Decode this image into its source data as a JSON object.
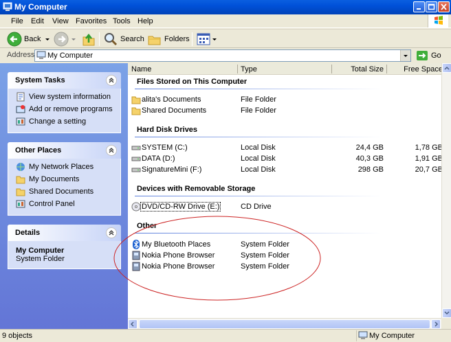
{
  "window": {
    "title": "My Computer"
  },
  "menu": [
    "File",
    "Edit",
    "View",
    "Favorites",
    "Tools",
    "Help"
  ],
  "toolbar": {
    "back": "Back",
    "search": "Search",
    "folders": "Folders"
  },
  "address": {
    "label": "Address",
    "value": "My Computer",
    "go": "Go"
  },
  "left_pane": {
    "system_tasks": {
      "title": "System Tasks",
      "items": [
        "View system information",
        "Add or remove programs",
        "Change a setting"
      ]
    },
    "other_places": {
      "title": "Other Places",
      "items": [
        "My Network Places",
        "My Documents",
        "Shared Documents",
        "Control Panel"
      ]
    },
    "details": {
      "title": "Details",
      "name": "My Computer",
      "desc": "System Folder"
    }
  },
  "columns": {
    "name": "Name",
    "type": "Type",
    "total_size": "Total Size",
    "free_space": "Free Space"
  },
  "groups": {
    "files": {
      "title": "Files Stored on This Computer",
      "rows": [
        {
          "name": "alita's Documents",
          "type": "File Folder"
        },
        {
          "name": "Shared Documents",
          "type": "File Folder"
        }
      ]
    },
    "hdd": {
      "title": "Hard Disk Drives",
      "rows": [
        {
          "name": "SYSTEM (C:)",
          "type": "Local Disk",
          "total": "24,4 GB",
          "free": "1,78 GB"
        },
        {
          "name": "DATA (D:)",
          "type": "Local Disk",
          "total": "40,3 GB",
          "free": "1,91 GB"
        },
        {
          "name": "SignatureMini (F:)",
          "type": "Local Disk",
          "total": "298 GB",
          "free": "20,7 GB"
        }
      ]
    },
    "removable": {
      "title": "Devices with Removable Storage",
      "rows": [
        {
          "name": "DVD/CD-RW Drive (E:)",
          "type": "CD Drive"
        }
      ]
    },
    "other": {
      "title": "Other",
      "rows": [
        {
          "name": "My Bluetooth Places",
          "type": "System Folder"
        },
        {
          "name": "Nokia Phone Browser",
          "type": "System Folder"
        },
        {
          "name": "Nokia Phone Browser",
          "type": "System Folder"
        }
      ]
    }
  },
  "status": {
    "objects": "9 objects",
    "location": "My Computer"
  },
  "colors": {
    "titlebar": "#0050d8",
    "taskpane": "#6375d6",
    "annotation": "#cc2222"
  }
}
